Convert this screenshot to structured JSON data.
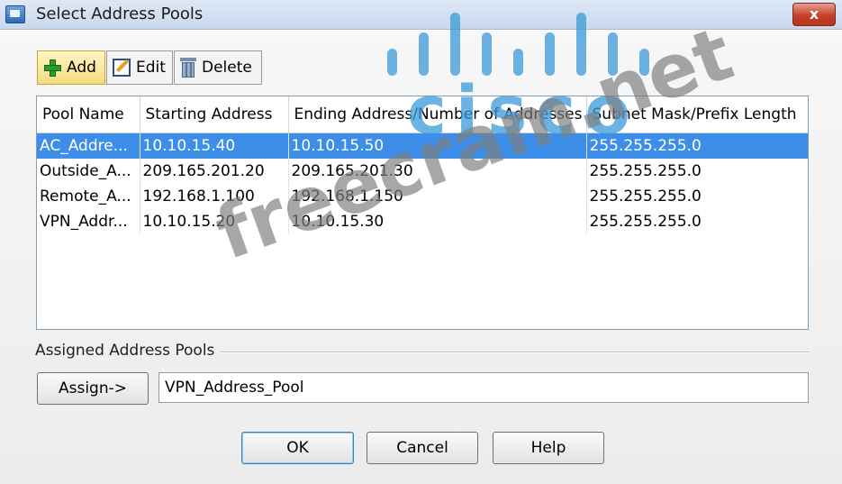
{
  "window": {
    "title": "Select Address Pools",
    "close_label": "x"
  },
  "toolbar": {
    "add_label": "Add",
    "edit_label": "Edit",
    "delete_label": "Delete"
  },
  "table": {
    "columns": [
      "Pool Name",
      "Starting Address",
      "Ending Address/Number of Addresses",
      "Subnet Mask/Prefix Length"
    ],
    "rows": [
      [
        "AC_Addre...",
        "10.10.15.40",
        "10.10.15.50",
        "255.255.255.0"
      ],
      [
        "Outside_A...",
        "209.165.201.20",
        "209.165.201.30",
        "255.255.255.0"
      ],
      [
        "Remote_A...",
        "192.168.1.100",
        "192.168.1.150",
        "255.255.255.0"
      ],
      [
        "VPN_Addr...",
        "10.10.15.20",
        "10.10.15.30",
        "255.255.255.0"
      ]
    ],
    "selected_row": 0
  },
  "assigned": {
    "group_label": "Assigned Address Pools",
    "assign_label": "Assign->",
    "value": "VPN_Address_Pool"
  },
  "footer": {
    "ok_label": "OK",
    "cancel_label": "Cancel",
    "help_label": "Help"
  },
  "watermark": {
    "logo_text": "cisco",
    "site_text": "freecram.net"
  },
  "colors": {
    "selection": "#3d8ee8",
    "watermark_blue": "#3a9ad9"
  }
}
